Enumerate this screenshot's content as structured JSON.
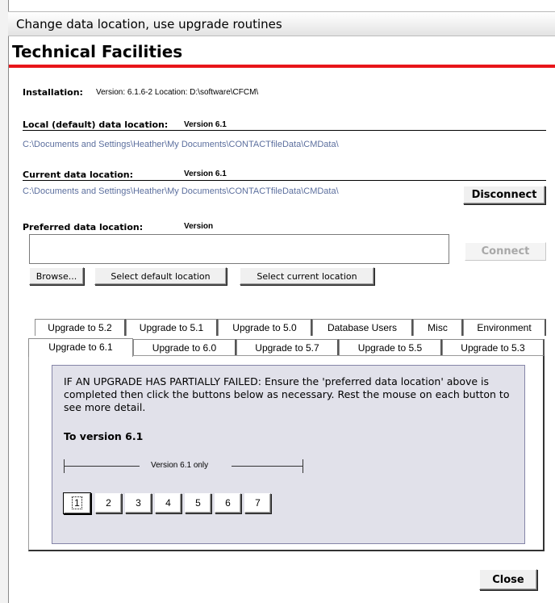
{
  "window": {
    "title": "Change data location, use upgrade routines"
  },
  "page": {
    "heading": "Technical Facilities"
  },
  "installation": {
    "label": "Installation:",
    "value": "Version: 6.1.6-2 Location: D:\\software\\CFCM\\"
  },
  "local_location": {
    "label": "Local (default) data location:",
    "version": "Version 6.1",
    "path": "C:\\Documents and Settings\\Heather\\My Documents\\CONTACTfileData\\CMData\\"
  },
  "current_location": {
    "label": "Current data location:",
    "version": "Version 6.1",
    "path": "C:\\Documents and Settings\\Heather\\My Documents\\CONTACTfileData\\CMData\\",
    "disconnect_label": "Disconnect"
  },
  "preferred_location": {
    "label": "Preferred data location:",
    "version": "Version",
    "input_value": "",
    "connect_label": "Connect",
    "browse_label": "Browse...",
    "select_default_label": "Select default location",
    "select_current_label": "Select current location"
  },
  "tabs": {
    "row_back": [
      {
        "label": "Upgrade to 5.2"
      },
      {
        "label": "Upgrade to 5.1"
      },
      {
        "label": "Upgrade to 5.0"
      },
      {
        "label": "Database Users"
      },
      {
        "label": "Misc"
      },
      {
        "label": "Environment"
      }
    ],
    "row_front": [
      {
        "label": "Upgrade to 6.1",
        "active": true
      },
      {
        "label": "Upgrade to 6.0"
      },
      {
        "label": "Upgrade to 5.7"
      },
      {
        "label": "Upgrade to 5.5"
      },
      {
        "label": "Upgrade to 5.3"
      }
    ]
  },
  "upgrade_panel": {
    "note": "IF AN UPGRADE HAS PARTIALLY FAILED: Ensure the 'preferred data location' above is completed then click the buttons below as necessary.  Rest the mouse on each button to see more detail.",
    "subheading": "To version 6.1",
    "range_label": "Version 6.1 only",
    "step_buttons": [
      "1",
      "2",
      "3",
      "4",
      "5",
      "6",
      "7"
    ]
  },
  "footer": {
    "close_label": "Close"
  }
}
